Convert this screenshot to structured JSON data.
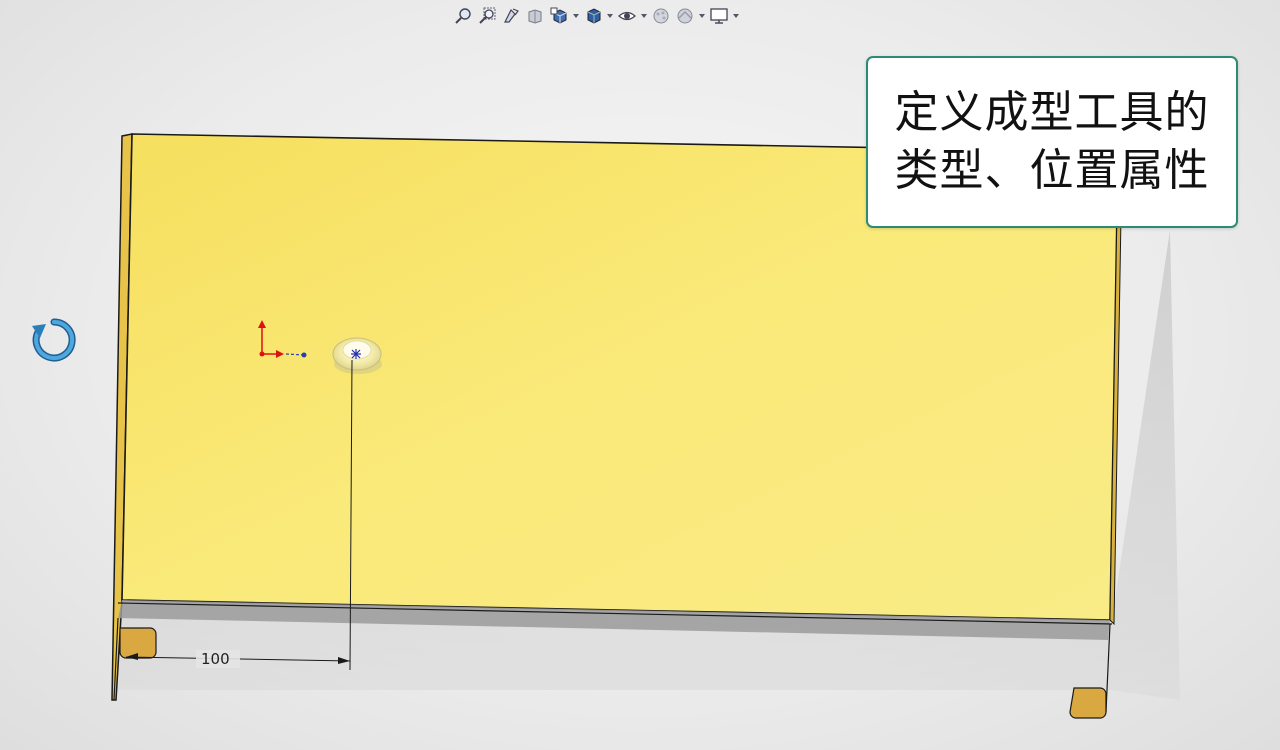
{
  "toolbar": {
    "icons": [
      "zoom-to-fit-icon",
      "zoom-to-area-icon",
      "previous-view-icon",
      "section-view-icon",
      "view-orientation-icon",
      "display-style-icon",
      "hide-show-items-icon",
      "edit-appearance-icon",
      "apply-scene-icon",
      "view-settings-icon"
    ]
  },
  "callout": {
    "line1": "定义成型工具的",
    "line2": "类型、位置属性"
  },
  "dimension": {
    "value": "100"
  },
  "colors": {
    "part_face": "#f8e46a",
    "part_edge": "#1a1a1a",
    "callout_border": "#2e8b73",
    "rotate_icon": "#2a7fb8"
  }
}
